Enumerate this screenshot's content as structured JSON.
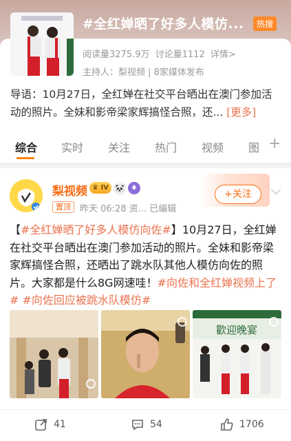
{
  "topic": {
    "title": "#全红婵晒了好多人模仿...",
    "hot_badge": "热搜",
    "reads_label": "阅读量3275.9万",
    "discuss_label": "讨论量1112",
    "detail_label": "详情>",
    "host_label": "主持人：梨视频 | 8家媒体发布",
    "intro_text": "导语：10月27日，全红婵在社交平台晒出在澳门参加活动的照片。全妹和影帝梁家辉搞怪合照，还...",
    "more_label": "[更多]"
  },
  "tabs": [
    "综合",
    "实时",
    "关注",
    "热门",
    "视频",
    "图"
  ],
  "post": {
    "author": "梨视频",
    "level": "IV",
    "top_tag": "置顶",
    "meta": "昨天 06:28  资...  已编辑",
    "follow_label": "+关注",
    "body_parts": [
      {
        "text": "【",
        "tag": false
      },
      {
        "text": "#全红婵晒了好多人模仿向佐#",
        "tag": true
      },
      {
        "text": "】10月27日，全红婵在社交平台晒出在澳门参加活动的照片。全妹和影帝梁家辉搞怪合照，还晒出了跳水队其他人模仿向佐的照片。大家都是什么8G网速哇！",
        "tag": false
      },
      {
        "text": "#向佐和全红婵视频上了#",
        "tag": true
      },
      {
        "text": " ",
        "tag": false
      },
      {
        "text": "#向佐回应被跳水队模仿#",
        "tag": true
      }
    ],
    "banner_text": "歡迎晚宴",
    "repost_count": "41",
    "comment_count": "54",
    "like_count": "1706"
  },
  "colors": {
    "accent": "#f86c14",
    "tag": "#eb7350",
    "tab_underline": "#ff8200"
  }
}
